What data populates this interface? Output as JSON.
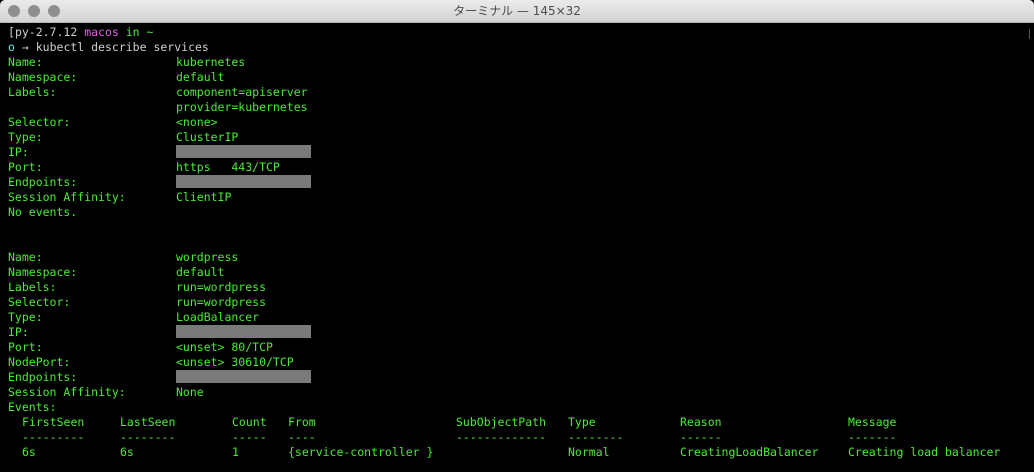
{
  "window": {
    "title": "ターミナル — 145×32"
  },
  "prompt": {
    "env": "py-2.7.12",
    "host": "macos",
    "in_text": "in",
    "path": "~",
    "symbol": "o",
    "arrow": "→",
    "command": "kubectl describe services"
  },
  "service1": {
    "name_label": "Name:",
    "name": "kubernetes",
    "namespace_label": "Namespace:",
    "namespace": "default",
    "labels_label": "Labels:",
    "label1": "component=apiserver",
    "label2": "provider=kubernetes",
    "selector_label": "Selector:",
    "selector": "<none>",
    "type_label": "Type:",
    "type": "ClusterIP",
    "ip_label": "IP:",
    "port_label": "Port:",
    "port": "https   443/TCP",
    "endpoints_label": "Endpoints:",
    "affinity_label": "Session Affinity:",
    "affinity": "ClientIP",
    "events": "No events."
  },
  "service2": {
    "name_label": "Name:",
    "name": "wordpress",
    "namespace_label": "Namespace:",
    "namespace": "default",
    "labels_label": "Labels:",
    "labels": "run=wordpress",
    "selector_label": "Selector:",
    "selector": "run=wordpress",
    "type_label": "Type:",
    "type": "LoadBalancer",
    "ip_label": "IP:",
    "port_label": "Port:",
    "port": "<unset> 80/TCP",
    "nodeport_label": "NodePort:",
    "nodeport": "<unset> 30610/TCP",
    "endpoints_label": "Endpoints:",
    "affinity_label": "Session Affinity:",
    "affinity": "None",
    "events_label": "Events:"
  },
  "events_table": {
    "headers": [
      "FirstSeen",
      "LastSeen",
      "Count",
      "From",
      "SubObjectPath",
      "Type",
      "Reason",
      "Message"
    ],
    "underlines": [
      "---------",
      "--------",
      "-----",
      "----",
      "-------------",
      "--------",
      "------",
      "-------"
    ],
    "row": [
      "6s",
      "6s",
      "1",
      "{service-controller }",
      "",
      "Normal",
      "CreatingLoadBalancer",
      "Creating load balancer"
    ]
  }
}
